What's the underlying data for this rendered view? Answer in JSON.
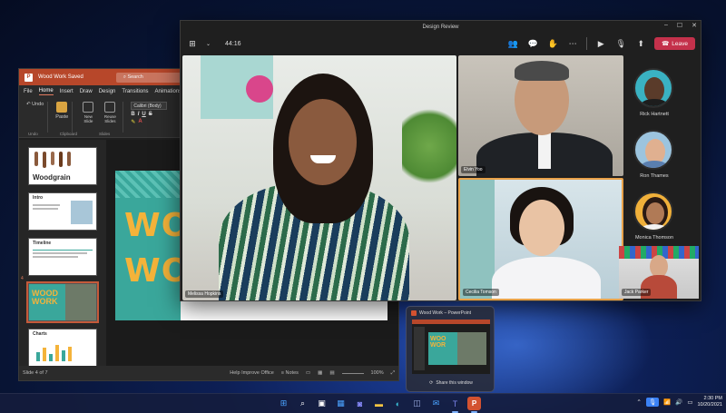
{
  "powerpoint": {
    "window_title": "Wood Work  Saved",
    "search_placeholder": "Search",
    "menu": [
      "File",
      "Home",
      "Insert",
      "Draw",
      "Design",
      "Transitions",
      "Animations"
    ],
    "ribbon": {
      "undo": "Undo",
      "paste": "Paste",
      "new_slide": "New Slide",
      "reuse_slides": "Reuse Slides",
      "font": "Calibri (Body)",
      "groups": [
        "Undo",
        "Clipboard",
        "Slides",
        "Font"
      ]
    },
    "thumbnails": [
      {
        "num": "1",
        "title": "Woodgrain"
      },
      {
        "num": "2",
        "title": "Intro"
      },
      {
        "num": "3",
        "title": "Timeline"
      },
      {
        "num": "4",
        "title": "WOOD WORK"
      },
      {
        "num": "5",
        "title": "Charts"
      }
    ],
    "slide_text_1": "WOO",
    "slide_text_2": "WOR",
    "status": {
      "slide_count": "Slide 4 of 7",
      "help": "Help Improve Office",
      "notes": "Notes",
      "zoom": "100%"
    }
  },
  "teams": {
    "window_title": "Design Review",
    "timer": "44:16",
    "leave": "Leave",
    "participants": {
      "main": "Melissa Hopkins",
      "top_right": "Elvin Yoo",
      "bottom_right": "Cecilia Tomson"
    },
    "sidebar": [
      {
        "name": "Rick Hartnett"
      },
      {
        "name": "Ron Thames"
      },
      {
        "name": "Monica Thomson"
      },
      {
        "name": "Jack Parker"
      }
    ]
  },
  "preview": {
    "title": "Wood Work – PowerPoint",
    "share": "Share this window"
  },
  "taskbar": {
    "time": "2:30 PM",
    "date": "10/20/2021"
  },
  "colors": {
    "ppt_accent": "#b7472a",
    "teams_leave": "#c4314b",
    "slide_teal": "#3aa79b",
    "slide_yellow": "#f4b33a"
  }
}
